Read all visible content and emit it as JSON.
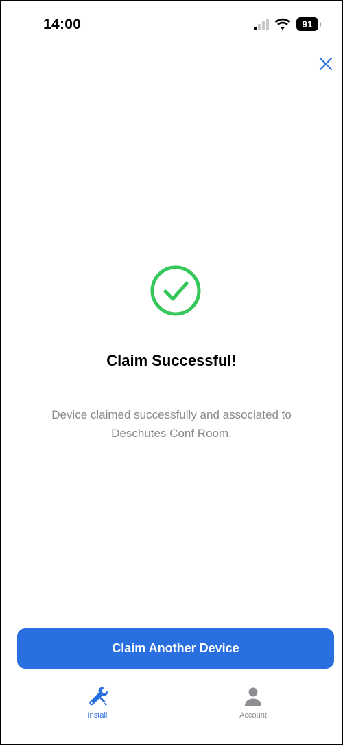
{
  "status_bar": {
    "time": "14:00",
    "battery": "91",
    "signal_icon": "cellular-signal-icon",
    "wifi_icon": "wifi-icon"
  },
  "close_icon": "close-icon",
  "success": {
    "icon": "checkmark-circle-icon",
    "title": "Claim Successful!",
    "message": "Device claimed successfully and associated to Deschutes Conf Room."
  },
  "primary_button": {
    "label": "Claim Another Device"
  },
  "tab_bar": {
    "tabs": [
      {
        "label": "Install",
        "icon": "wrench-screwdriver-icon",
        "active": true
      },
      {
        "label": "Account",
        "icon": "person-icon",
        "active": false
      }
    ]
  },
  "colors": {
    "accent": "#2a6fe0",
    "success": "#34c759",
    "muted_text": "#8a8a8e",
    "inactive_tab": "#8e8e93"
  }
}
